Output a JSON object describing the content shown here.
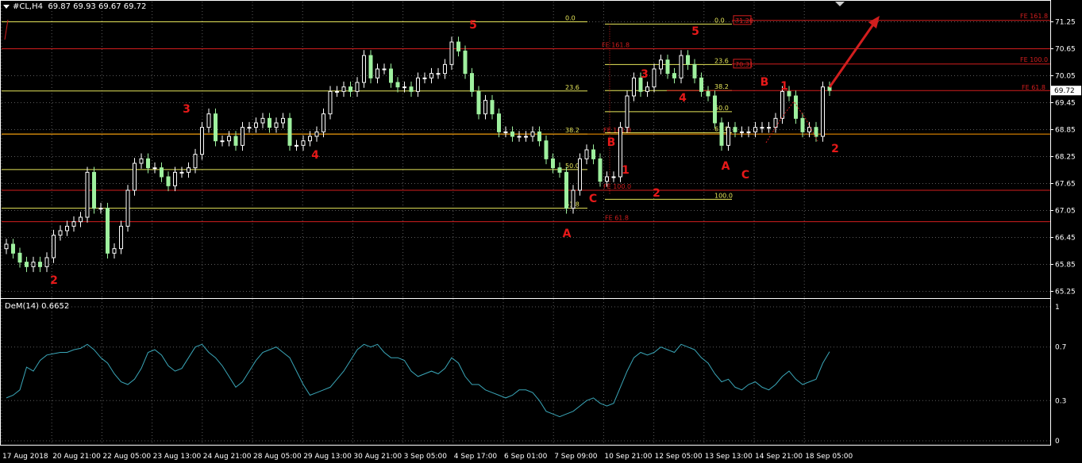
{
  "header": {
    "symbol": "#CL,H4",
    "ohlc": "69.87 69.93 69.67 69.72"
  },
  "indicator": {
    "label": "DeM(14) 0.6652",
    "axis_ticks": [
      "1",
      "0.7",
      "0.3",
      "0"
    ]
  },
  "current_price_label": "69.72",
  "colors": {
    "background": "#000000",
    "grid": "#5a5a5a",
    "bull_candle": "#ffffff",
    "bear_candle": "#9ef09e",
    "fib_retracement": "#e6e65a",
    "fib_extension": "#d21e1e",
    "wave_label": "#e61919",
    "indicator_line": "#3aa6b8",
    "price_level_orange": "#ff9900"
  },
  "chart_data": [
    {
      "type": "candlestick",
      "name": "main",
      "y_ticks": [
        "71.25",
        "70.65",
        "70.05",
        "69.45",
        "68.85",
        "68.25",
        "67.65",
        "67.05",
        "66.45",
        "65.85",
        "65.25"
      ],
      "ylim": [
        65.1,
        71.7
      ],
      "x_ticks": [
        "17 Aug 2018",
        "20 Aug 21:00",
        "22 Aug 05:00",
        "23 Aug 13:00",
        "24 Aug 21:00",
        "28 Aug 05:00",
        "29 Aug 13:00",
        "30 Aug 21:00",
        "3 Sep 05:00",
        "4 Sep 17:00",
        "6 Sep 01:00",
        "7 Sep 09:00",
        "10 Sep 21:00",
        "12 Sep 05:00",
        "13 Sep 13:00",
        "14 Sep 21:00",
        "18 Sep 05:00"
      ],
      "closes": [
        66.3,
        66.1,
        65.9,
        65.8,
        65.9,
        65.8,
        66.0,
        66.5,
        66.6,
        66.7,
        66.8,
        66.9,
        67.9,
        67.1,
        67.1,
        66.1,
        66.2,
        66.7,
        67.5,
        68.1,
        68.2,
        68.0,
        68.0,
        67.8,
        67.6,
        67.9,
        67.9,
        68.0,
        68.3,
        68.9,
        69.2,
        68.6,
        68.6,
        68.7,
        68.5,
        68.9,
        68.9,
        69.0,
        69.1,
        68.9,
        69.0,
        69.1,
        68.5,
        68.5,
        68.6,
        68.7,
        68.8,
        69.2,
        69.7,
        69.7,
        69.8,
        69.7,
        69.9,
        70.5,
        70.0,
        70.2,
        70.2,
        69.9,
        69.8,
        69.8,
        69.7,
        70.0,
        70.0,
        70.1,
        70.1,
        70.3,
        70.8,
        70.6,
        70.1,
        69.7,
        69.2,
        69.5,
        69.2,
        68.8,
        68.8,
        68.7,
        68.7,
        68.7,
        68.8,
        68.6,
        68.2,
        68.0,
        67.9,
        67.1,
        67.5,
        68.2,
        68.4,
        68.2,
        67.7,
        67.8,
        67.8,
        68.9,
        69.6,
        70.0,
        69.7,
        69.8,
        70.2,
        70.4,
        70.1,
        70.0,
        70.5,
        70.3,
        70.0,
        69.7,
        69.6,
        69.0,
        68.5,
        68.9,
        68.8,
        68.8,
        68.8,
        68.9,
        68.9,
        68.9,
        69.1,
        69.7,
        69.6,
        69.1,
        68.8,
        68.9,
        68.7,
        69.8,
        69.72
      ],
      "annotations": {
        "wave_labels": [
          "2",
          "3",
          "4",
          "5",
          "A",
          "C",
          "B",
          "1",
          "2",
          "3",
          "4",
          "5",
          "A",
          "C",
          "B",
          "1",
          "2"
        ],
        "fib_retracement_levels": [
          "0.0",
          "23.6",
          "38.2",
          "50.0",
          "61.8",
          "100.0"
        ],
        "fib_extension_levels": [
          "FE 161.8",
          "FE 100.0",
          "FE 61.8"
        ],
        "price_boxes": [
          "71.28",
          "70.31"
        ]
      }
    },
    {
      "type": "line",
      "name": "DeM(14)",
      "ylim": [
        0,
        1
      ],
      "values": [
        0.32,
        0.34,
        0.38,
        0.55,
        0.52,
        0.6,
        0.64,
        0.65,
        0.66,
        0.66,
        0.68,
        0.69,
        0.72,
        0.68,
        0.62,
        0.58,
        0.5,
        0.44,
        0.42,
        0.46,
        0.54,
        0.66,
        0.68,
        0.64,
        0.56,
        0.52,
        0.54,
        0.62,
        0.7,
        0.72,
        0.66,
        0.62,
        0.56,
        0.48,
        0.4,
        0.44,
        0.52,
        0.6,
        0.66,
        0.68,
        0.7,
        0.66,
        0.62,
        0.52,
        0.42,
        0.34,
        0.36,
        0.38,
        0.4,
        0.46,
        0.52,
        0.6,
        0.68,
        0.72,
        0.7,
        0.72,
        0.66,
        0.62,
        0.62,
        0.6,
        0.52,
        0.48,
        0.5,
        0.52,
        0.5,
        0.54,
        0.62,
        0.58,
        0.48,
        0.42,
        0.42,
        0.38,
        0.36,
        0.34,
        0.32,
        0.34,
        0.38,
        0.38,
        0.36,
        0.3,
        0.22,
        0.2,
        0.18,
        0.2,
        0.22,
        0.26,
        0.3,
        0.32,
        0.28,
        0.26,
        0.28,
        0.4,
        0.52,
        0.62,
        0.66,
        0.64,
        0.66,
        0.7,
        0.68,
        0.66,
        0.72,
        0.7,
        0.68,
        0.62,
        0.58,
        0.5,
        0.44,
        0.46,
        0.4,
        0.38,
        0.42,
        0.44,
        0.4,
        0.38,
        0.42,
        0.48,
        0.52,
        0.46,
        0.42,
        0.44,
        0.46,
        0.58,
        0.6652
      ]
    }
  ]
}
